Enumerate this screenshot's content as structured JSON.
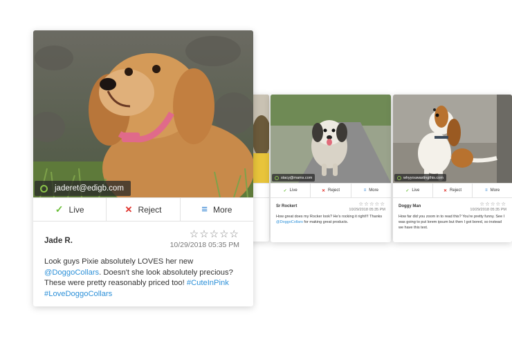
{
  "main_card": {
    "email": "jaderet@edigb.com",
    "actions": {
      "live": "Live",
      "reject": "Reject",
      "more": "More"
    },
    "author": "Jade R.",
    "stars": "☆☆☆☆☆",
    "date": "10/29/2018 05:35 PM",
    "text_1": "Look guys Pixie absolutely LOVES her new ",
    "mention": "@DoggoCollars",
    "text_2": ". Doesn't she look absolutely precious? These were pretty reasonably priced too! ",
    "hashtags": "#CuteInPink #LoveDoggoCollars"
  },
  "card_2": {
    "email": "stacy@mams.com",
    "actions": {
      "live": "Live",
      "reject": "Reject",
      "more": "More"
    },
    "author": "Sr Rockert",
    "stars": "☆☆☆☆☆",
    "date": "10/29/2018 05:35 PM",
    "text_1": "How great does my Rocker look? He's rocking it right!!! Thanks ",
    "mention": "@DoggoCollars",
    "text_2": " for making great products."
  },
  "card_3": {
    "email": "whyyouwastingthis.com",
    "actions": {
      "live": "Live",
      "reject": "Reject",
      "more": "More"
    },
    "author": "Doggy Man",
    "stars": "☆☆☆☆☆",
    "date": "10/29/2018 05:35 PM",
    "text_1": "How far did you zoom in to read this? You're pretty funny. See I was going to put lorem ipsum but then I got bored, so instead we have this text."
  },
  "colors": {
    "live": "#6cbf3a",
    "reject": "#e0332c",
    "more": "#2a7fd0",
    "link": "#2a8fd8",
    "status_ring": "#8bc34a"
  },
  "icons": {
    "live": "check-icon",
    "reject": "x-icon",
    "more": "menu-icon",
    "status": "status-ring-icon"
  }
}
